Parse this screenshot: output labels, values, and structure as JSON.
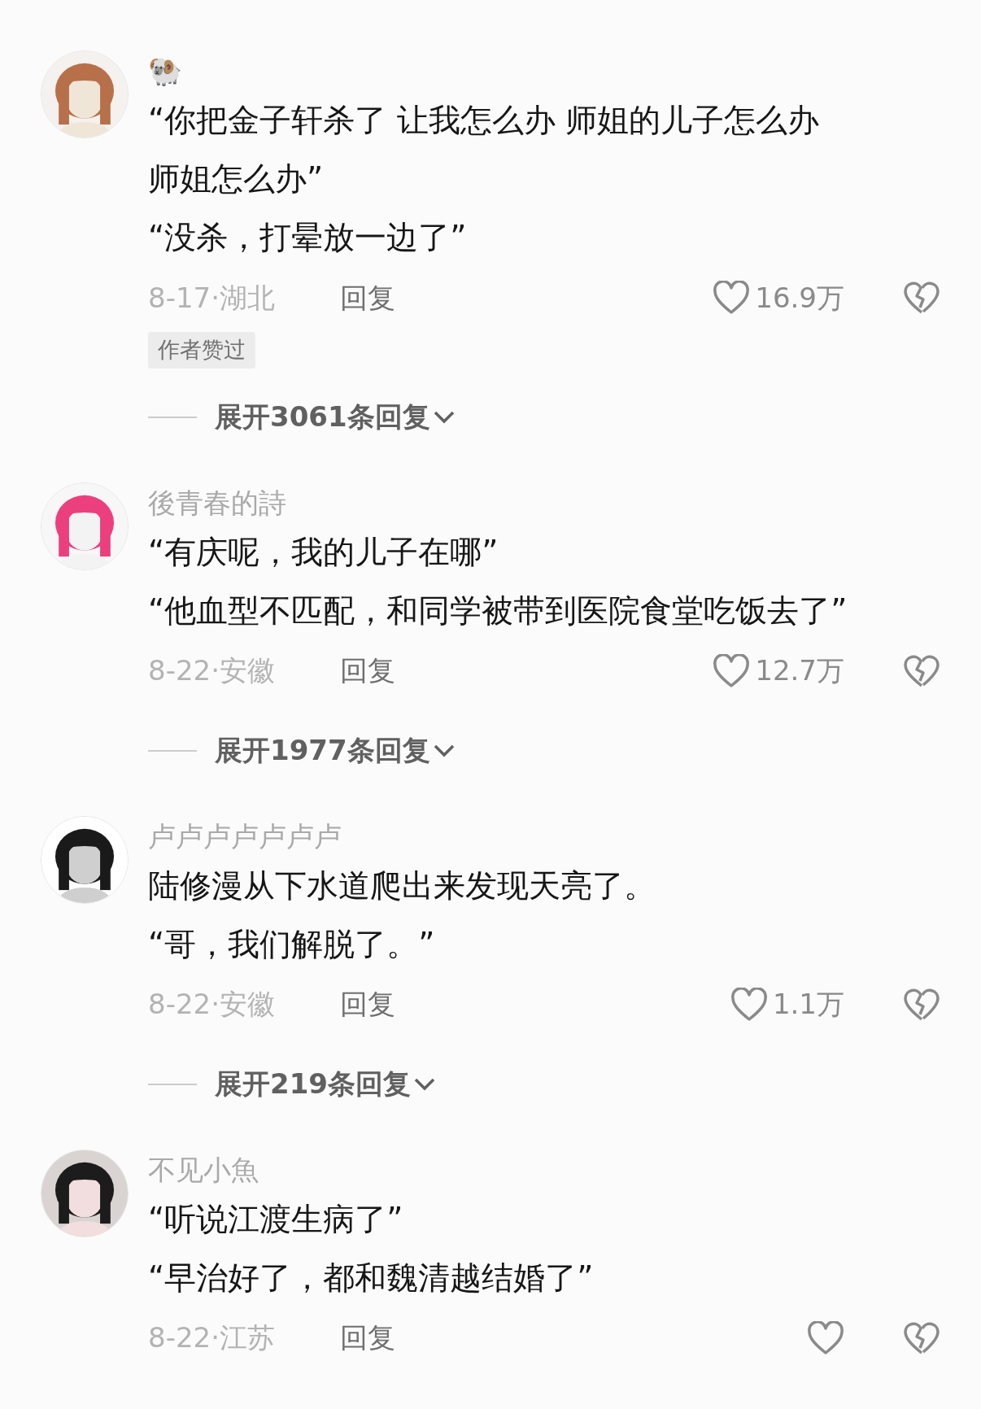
{
  "comments": [
    {
      "username": "🐏",
      "lines": [
        "“你把金子轩杀了 让我怎么办 师姐的儿子怎么办",
        "师姐怎么办”",
        "“没杀，打晕放一边了”"
      ],
      "meta": "8-17·湖北",
      "reply": "回复",
      "likes": "16.9万",
      "badge": "作者赞过",
      "expand": "展开3061条回复",
      "avatar": {
        "kind": "picture"
      }
    },
    {
      "username": "後青春的詩",
      "lines": [
        "“有庆呢，我的儿子在哪”",
        "“他血型不匹配，和同学被带到医院食堂吃饭去了”"
      ],
      "meta": "8-22·安徽",
      "reply": "回复",
      "likes": "12.7万",
      "expand": "展开1977条回复",
      "avatar": {
        "kind": "picture"
      }
    },
    {
      "username": "卢卢卢卢卢卢卢",
      "lines": [
        "陆修漫从下水道爬出来发现天亮了。",
        "“哥，我们解脱了。”"
      ],
      "meta": "8-22·安徽",
      "reply": "回复",
      "likes": "1.1万",
      "expand": "展开219条回复",
      "avatar": {
        "kind": "picture"
      }
    },
    {
      "username": "不见小魚",
      "lines": [
        "“听说江渡生病了”",
        "“早治好了，都和魏清越结婚了”"
      ],
      "meta": "8-22·江苏",
      "reply": "回复",
      "avatar": {
        "kind": "picture"
      }
    }
  ]
}
